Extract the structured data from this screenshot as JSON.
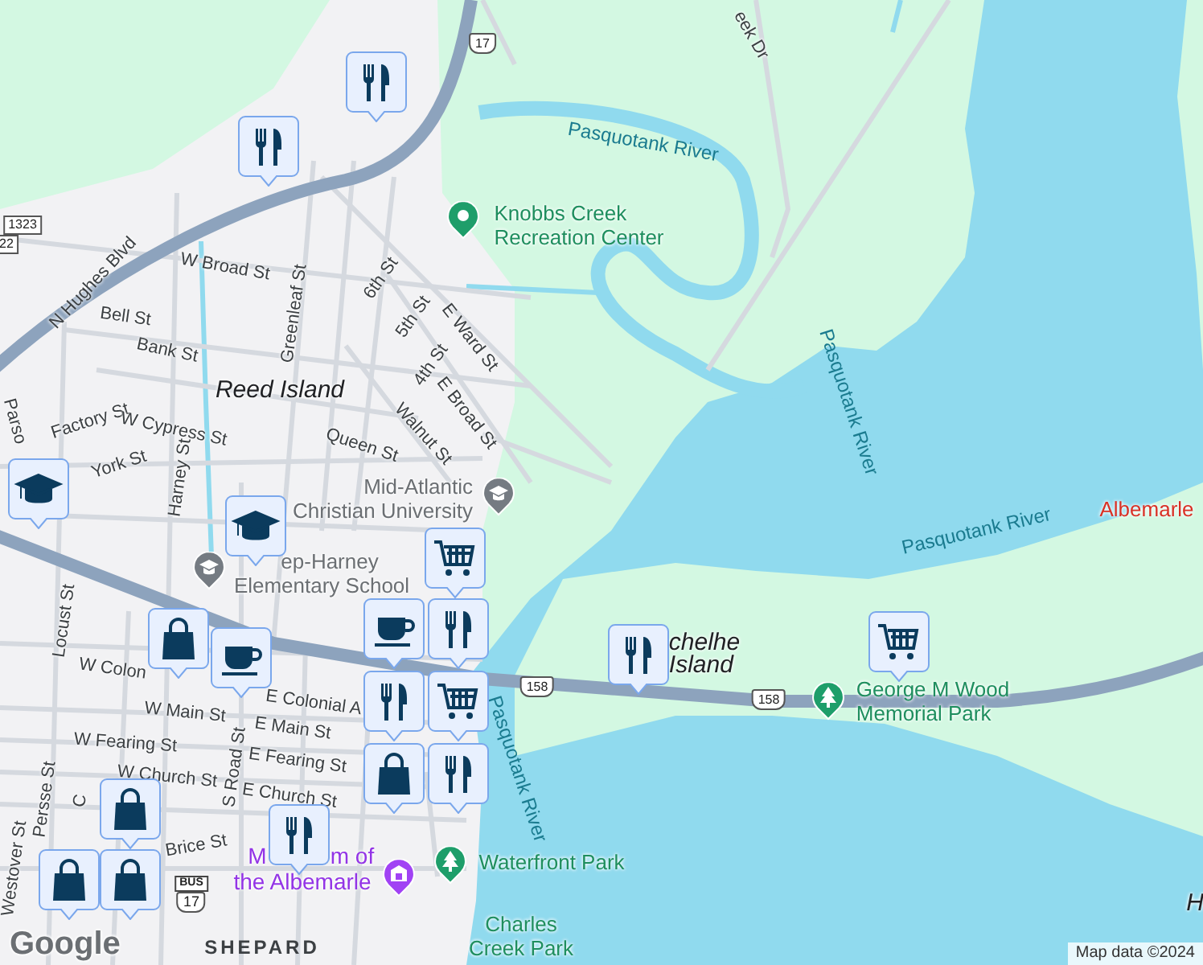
{
  "labels": [
    {
      "text": "Pasquotank River",
      "kind": "water"
    },
    {
      "text": "Knobbs Creek\nRecreation Center",
      "kind": "park"
    },
    {
      "text": "W Broad St",
      "kind": "street"
    },
    {
      "text": "6th St",
      "kind": "street"
    },
    {
      "text": "Greenleaf St",
      "kind": "street"
    },
    {
      "text": "5th St",
      "kind": "street"
    },
    {
      "text": "E Ward St",
      "kind": "street"
    },
    {
      "text": "Bell St",
      "kind": "street"
    },
    {
      "text": "Bank St",
      "kind": "street"
    },
    {
      "text": "N Hughes Blvd",
      "kind": "street"
    },
    {
      "text": "4th St",
      "kind": "street"
    },
    {
      "text": "Reed Island",
      "kind": "area"
    },
    {
      "text": "E Broad St",
      "kind": "street"
    },
    {
      "text": "Walnut St",
      "kind": "street"
    },
    {
      "text": "Factory St",
      "kind": "street"
    },
    {
      "text": "W Cypress St",
      "kind": "street"
    },
    {
      "text": "Queen St",
      "kind": "street"
    },
    {
      "text": "York St",
      "kind": "street"
    },
    {
      "text": "Harney St",
      "kind": "street"
    },
    {
      "text": "Mid-Atlantic\nChristian University",
      "kind": "poi"
    },
    {
      "text": "Parso",
      "kind": "street"
    },
    {
      "text": "Locust St",
      "kind": "street"
    },
    {
      "text": "ep-Harney",
      "kind": "poi"
    },
    {
      "text": "Elementary School",
      "kind": "poi"
    },
    {
      "text": "W Colon",
      "kind": "street"
    },
    {
      "text": "E Colonial A",
      "kind": "street"
    },
    {
      "text": "W Main St",
      "kind": "street"
    },
    {
      "text": "E Main St",
      "kind": "street"
    },
    {
      "text": "W Fearing St",
      "kind": "street"
    },
    {
      "text": "E Fearing St",
      "kind": "street"
    },
    {
      "text": "W Church St",
      "kind": "street"
    },
    {
      "text": "E Church St",
      "kind": "street"
    },
    {
      "text": "S Road St",
      "kind": "street"
    },
    {
      "text": "Persse St",
      "kind": "street"
    },
    {
      "text": "Westover St",
      "kind": "street"
    },
    {
      "text": "Brice St",
      "kind": "street"
    },
    {
      "text": "C",
      "kind": "street"
    },
    {
      "text": "M",
      "kind": "museum"
    },
    {
      "text": "m of",
      "kind": "museum"
    },
    {
      "text": "the Albemarle",
      "kind": "museum"
    },
    {
      "text": "Waterfront Park",
      "kind": "park"
    },
    {
      "text": "Pasquotank River",
      "kind": "water"
    },
    {
      "text": "SHEPARD",
      "kind": "district"
    },
    {
      "text": "Charles\nCreek Park",
      "kind": "park"
    },
    {
      "text": "Pasquotank River",
      "kind": "water"
    },
    {
      "text": "Pasquotank River",
      "kind": "water"
    },
    {
      "text": "Albemarle",
      "kind": "city"
    },
    {
      "text": "chelhe\nIsland",
      "kind": "area"
    },
    {
      "text": "George M Wood\nMemorial Park",
      "kind": "park"
    },
    {
      "text": "eek Dr",
      "kind": "street"
    },
    {
      "text": "H",
      "kind": "area"
    }
  ],
  "shields": [
    {
      "text": "17",
      "kind": "us"
    },
    {
      "text": "158",
      "kind": "us"
    },
    {
      "text": "158",
      "kind": "us"
    },
    {
      "text": "1323",
      "kind": "state"
    },
    {
      "text": "22",
      "kind": "state"
    },
    {
      "text": "17",
      "kind": "bus",
      "plate": "BUS"
    }
  ],
  "pins": [
    {
      "kind": "recreation"
    },
    {
      "kind": "school"
    },
    {
      "kind": "school"
    },
    {
      "kind": "museum"
    },
    {
      "kind": "park"
    },
    {
      "kind": "park"
    }
  ],
  "markers": [
    {
      "kind": "restaurant"
    },
    {
      "kind": "restaurant"
    },
    {
      "kind": "school"
    },
    {
      "kind": "school"
    },
    {
      "kind": "cart"
    },
    {
      "kind": "shopping"
    },
    {
      "kind": "cafe"
    },
    {
      "kind": "cafe"
    },
    {
      "kind": "restaurant"
    },
    {
      "kind": "restaurant"
    },
    {
      "kind": "cart"
    },
    {
      "kind": "shopping"
    },
    {
      "kind": "restaurant"
    },
    {
      "kind": "restaurant"
    },
    {
      "kind": "shopping"
    },
    {
      "kind": "shopping"
    },
    {
      "kind": "shopping"
    },
    {
      "kind": "restaurant"
    },
    {
      "kind": "cart"
    }
  ],
  "logo": "Google",
  "attribution": "Map data ©2024"
}
